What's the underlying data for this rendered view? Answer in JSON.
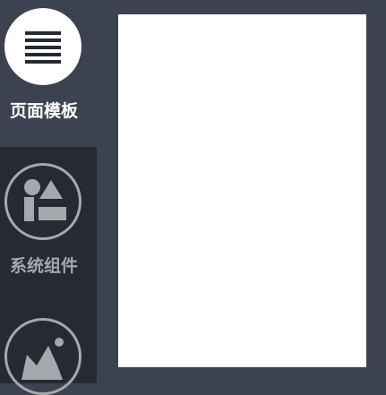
{
  "colors": {
    "background": "#3d4250",
    "sidebar_inactive": "#262a33",
    "icon_inactive": "#a6a8ad",
    "icon_active_bg": "#ffffff",
    "icon_active_fg": "#262a33",
    "canvas": "#ffffff"
  },
  "sidebar": {
    "items": [
      {
        "label": "页面模板",
        "icon": "lines-icon",
        "active": true
      },
      {
        "label": "系统组件",
        "icon": "shapes-icon",
        "active": false
      },
      {
        "label": "",
        "icon": "image-icon",
        "active": false
      }
    ]
  },
  "canvas": {
    "content": ""
  }
}
